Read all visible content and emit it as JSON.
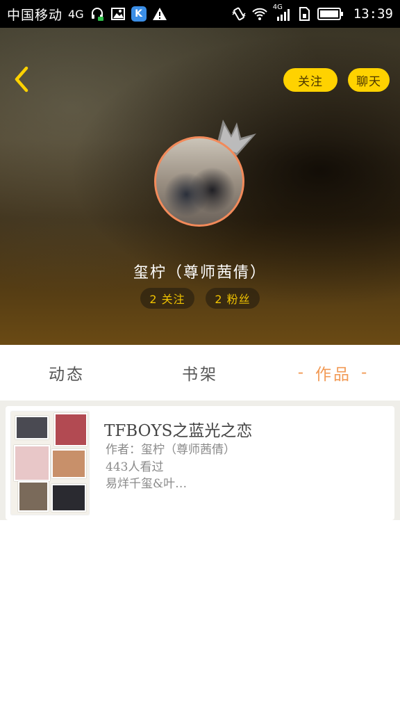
{
  "status_bar": {
    "carrier": "中国移动",
    "network": "4G",
    "network_right": "4G",
    "time": "13:39",
    "k_app": "K"
  },
  "header": {
    "follow_button": "关注",
    "chat_button": "聊天",
    "user_name": "玺柠（尊师茜倩）",
    "following": "2 关注",
    "followers": "2 粉丝"
  },
  "tabs": [
    {
      "label": "动态"
    },
    {
      "label": "书架"
    },
    {
      "label": "作品",
      "active": true,
      "dash": "-"
    }
  ],
  "works": [
    {
      "title": "TFBOYS之蓝光之恋",
      "author": "作者：玺柠（尊师茜倩）",
      "views": "443人看过",
      "description": "易烊千玺&叶…"
    }
  ],
  "colors": {
    "accent_yellow": "#ffd200",
    "tab_active": "#f29a55",
    "avatar_border": "#f28a5a"
  }
}
